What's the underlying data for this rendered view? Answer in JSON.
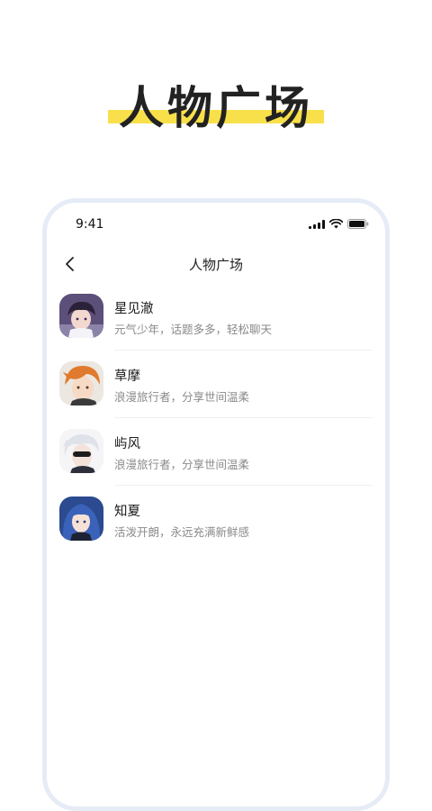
{
  "promo": {
    "title": "人物广场",
    "highlight_color": "#f8e04a"
  },
  "status_bar": {
    "time": "9:41",
    "icons": [
      "signal-icon",
      "wifi-icon",
      "battery-icon"
    ]
  },
  "nav": {
    "back_icon": "chevron-left-icon",
    "title": "人物广场"
  },
  "characters": [
    {
      "name": "星见澈",
      "description": "元气少年，话题多多，轻松聊天",
      "avatar_color": "#6a5a86"
    },
    {
      "name": "草摩",
      "description": "浪漫旅行者，分享世间温柔",
      "avatar_color": "#e0873c"
    },
    {
      "name": "屿风",
      "description": "浪漫旅行者，分享世间温柔",
      "avatar_color": "#d8dbe3"
    },
    {
      "name": "知夏",
      "description": "活泼开朗，永远充满新鲜感",
      "avatar_color": "#3a5fa8"
    }
  ]
}
